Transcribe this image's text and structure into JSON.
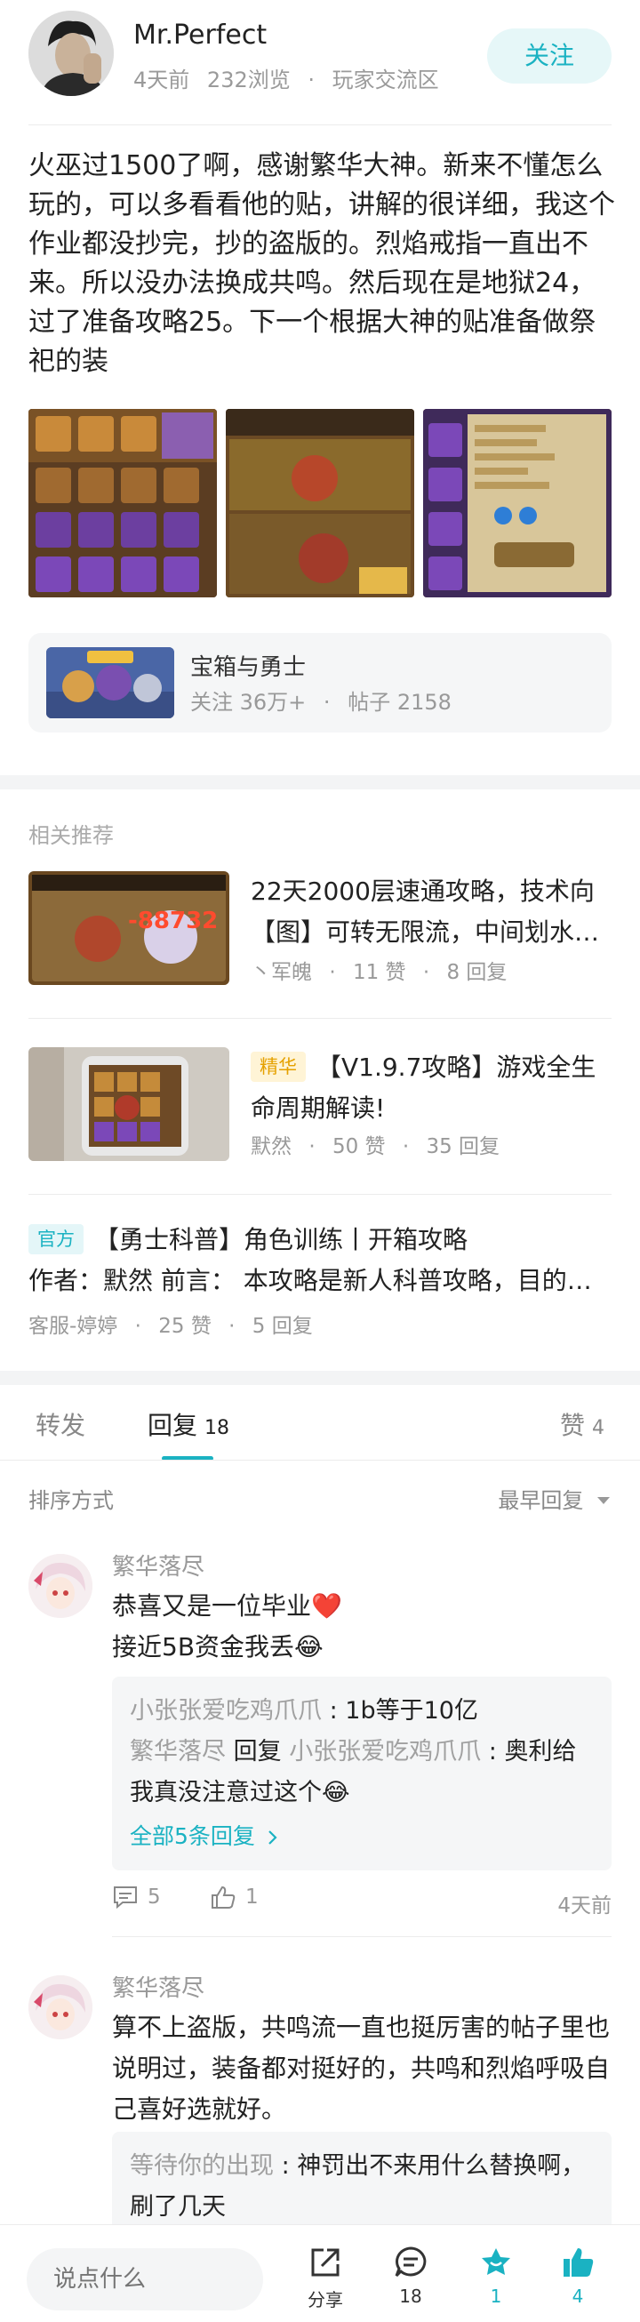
{
  "author": {
    "name": "Mr.Perfect",
    "time": "4天前",
    "views": "232浏览",
    "dot": "·",
    "section": "玩家交流区",
    "follow_label": "关注"
  },
  "post": {
    "body": "火巫过1500了啊，感谢繁华大神。新来不懂怎么玩的，可以多看看他的贴，讲解的很详细，我这个作业都没抄完，抄的盗版的。烈焰戒指一直出不来。所以没办法换成共鸣。然后现在是地狱24，过了准备攻略25。下一个根据大神的贴准备做祭祀的装"
  },
  "forum": {
    "name": "宝箱与勇士",
    "followers": "关注 36万+",
    "dot": "·",
    "posts": "帖子 2158"
  },
  "recommend": {
    "title": "相关推荐",
    "items": [
      {
        "title": "22天2000层速通攻略，技术向【图】可转无限流，中间划水…",
        "author": "丶军魄",
        "likes": "11 赞",
        "replies": "8 回复",
        "thumb_number": "-88732"
      },
      {
        "tag": "精华",
        "title": "【V1.9.7攻略】游戏全生命周期解读!",
        "author": "默然",
        "likes": "50 赞",
        "replies": "35 回复"
      },
      {
        "tag": "官方",
        "title": "【勇士科普】角色训练丨开箱攻略",
        "excerpt": "作者：默然 前言： 本攻略是新人科普攻略，目的…",
        "author": "客服-婷婷",
        "likes": "25 赞",
        "replies": "5 回复"
      }
    ],
    "dot": "·"
  },
  "tabs": {
    "forward": "转发",
    "reply": "回复",
    "reply_count": "18",
    "like": "赞",
    "like_count": "4"
  },
  "sort": {
    "label": "排序方式",
    "value": "最早回复"
  },
  "comments": [
    {
      "user": "繁华落尽",
      "lines": [
        "恭喜又是一位毕业❤️",
        "接近5B资金我丢😂"
      ],
      "replies": [
        {
          "user": "小张张爱吃鸡爪爪",
          "text": "1b等于10亿"
        },
        {
          "user": "繁华落尽",
          "mid": "回复",
          "target": "小张张爱吃鸡爪爪",
          "text": "奥利给我真没注意过这个😂"
        }
      ],
      "all_replies": "全部5条回复",
      "comment_count": "5",
      "like_count": "1",
      "time": "4天前"
    },
    {
      "user": "繁华落尽",
      "lines": [
        "算不上盗版，共鸣流一直也挺厉害的帖子里也说明过，装备都对挺好的，共鸣和烈焰呼吸自己喜好选就好。"
      ],
      "replies": [
        {
          "user": "等待你的出现",
          "text": "神罚出不来用什么替换啊，刷了几天"
        }
      ]
    }
  ],
  "bottom": {
    "placeholder": "说点什么",
    "share": "分享",
    "comments": "18",
    "collect": "1",
    "likes": "4"
  },
  "colors": {
    "accent": "#1ab2c2",
    "tag_gold": "#e5a100",
    "muted": "#999999"
  }
}
